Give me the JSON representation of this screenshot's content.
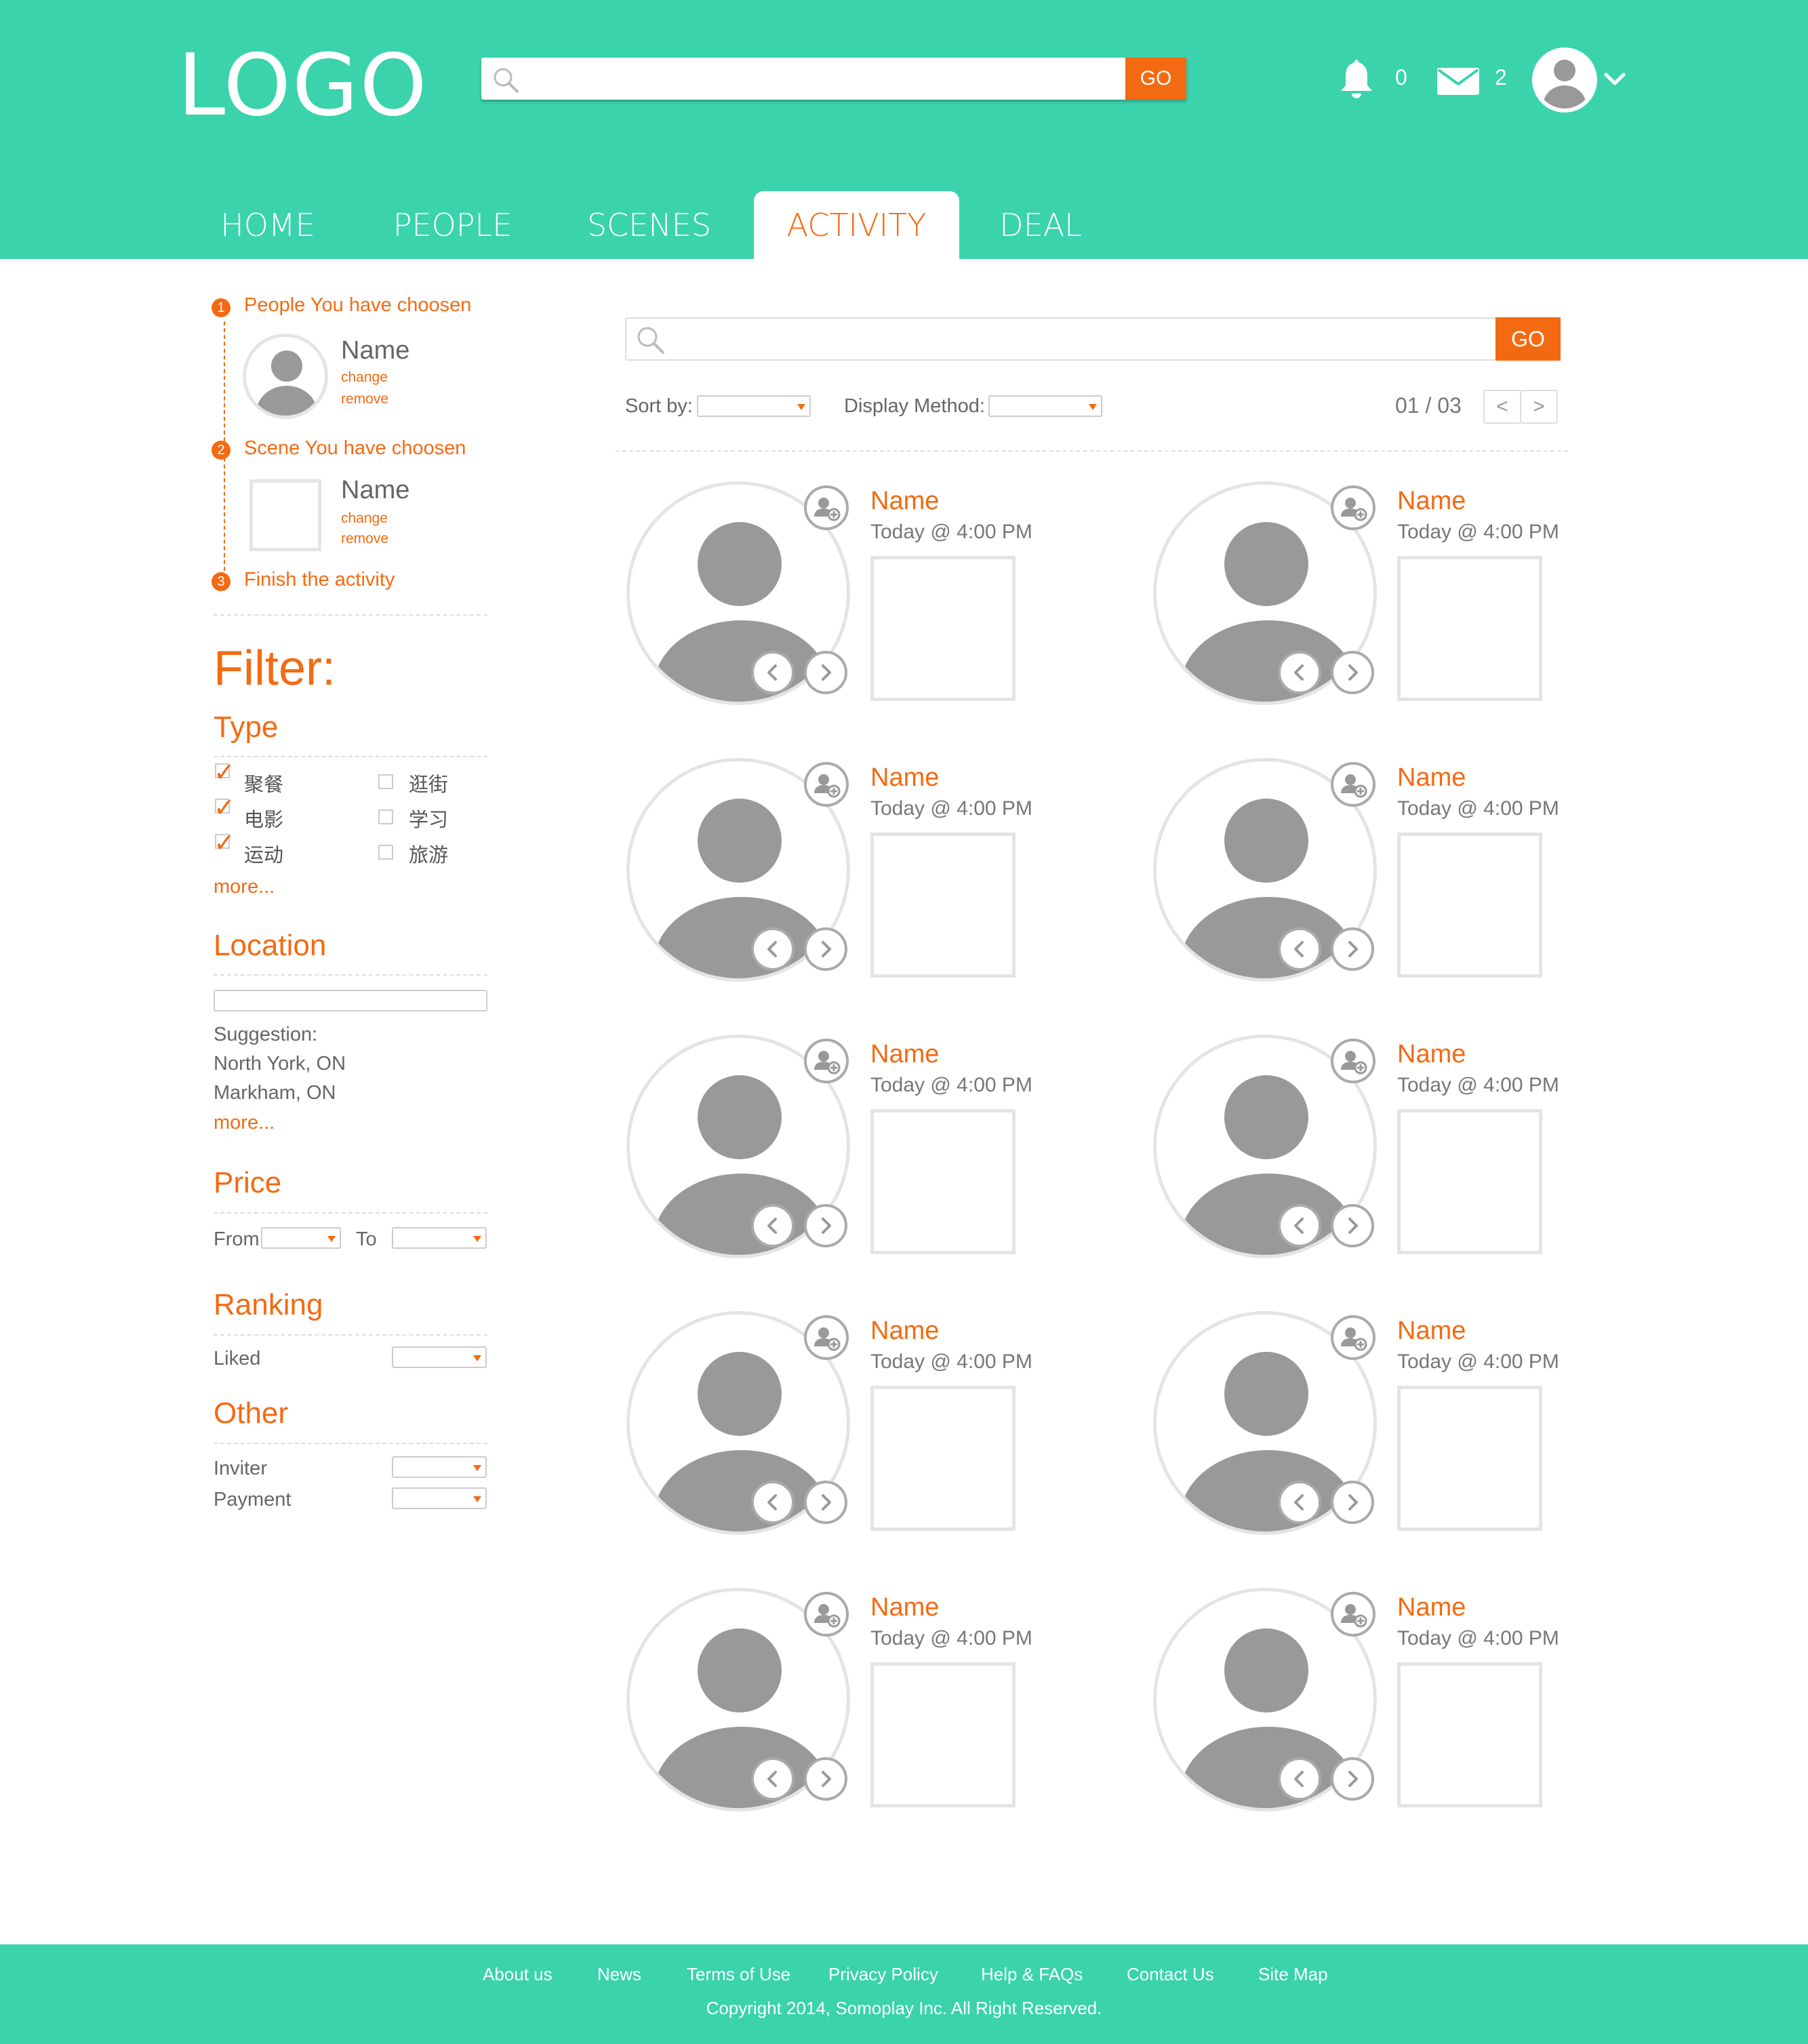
{
  "header": {
    "logo": "LOGO",
    "search_placeholder": "",
    "search_button": "GO",
    "notifications_count": "0",
    "messages_count": "2"
  },
  "nav": {
    "tabs": [
      {
        "label": "HOME"
      },
      {
        "label": "PEOPLE"
      },
      {
        "label": "SCENES"
      },
      {
        "label": "ACTIVITY",
        "active": true
      },
      {
        "label": "DEAL"
      }
    ]
  },
  "steps": [
    {
      "number": "1",
      "title": "People You have choosen",
      "name": "Name",
      "change": "change",
      "remove": "remove"
    },
    {
      "number": "2",
      "title": "Scene You have choosen",
      "name": "Name",
      "change": "change",
      "remove": "remove"
    },
    {
      "number": "3",
      "title": "Finish the activity"
    }
  ],
  "filter": {
    "title": "Filter:",
    "type": {
      "title": "Type",
      "options": [
        {
          "label": "聚餐",
          "checked": true
        },
        {
          "label": "逛街",
          "checked": false
        },
        {
          "label": "电影",
          "checked": true
        },
        {
          "label": "学习",
          "checked": false
        },
        {
          "label": "运动",
          "checked": true
        },
        {
          "label": "旅游",
          "checked": false
        }
      ],
      "more": "more..."
    },
    "location": {
      "title": "Location",
      "input_value": "",
      "suggestion_label": "Suggestion:",
      "suggestions": [
        "North York, ON",
        "Markham, ON"
      ],
      "more": "more..."
    },
    "price": {
      "title": "Price",
      "from_label": "From",
      "to_label": "To"
    },
    "ranking": {
      "title": "Ranking",
      "liked_label": "Liked"
    },
    "other": {
      "title": "Other",
      "inviter_label": "Inviter",
      "payment_label": "Payment"
    }
  },
  "main": {
    "search_button": "GO",
    "sort_label": "Sort by:",
    "display_label": "Display Method:",
    "page_current": "01",
    "page_sep": "/",
    "page_total": "03",
    "prev": "<",
    "next": ">",
    "cards": [
      {
        "name": "Name",
        "time": "Today @ 4:00 PM"
      },
      {
        "name": "Name",
        "time": "Today @ 4:00 PM"
      },
      {
        "name": "Name",
        "time": "Today @ 4:00 PM"
      },
      {
        "name": "Name",
        "time": "Today @ 4:00 PM"
      },
      {
        "name": "Name",
        "time": "Today @ 4:00 PM"
      },
      {
        "name": "Name",
        "time": "Today @ 4:00 PM"
      },
      {
        "name": "Name",
        "time": "Today @ 4:00 PM"
      },
      {
        "name": "Name",
        "time": "Today @ 4:00 PM"
      },
      {
        "name": "Name",
        "time": "Today @ 4:00 PM"
      },
      {
        "name": "Name",
        "time": "Today @ 4:00 PM"
      }
    ]
  },
  "footer": {
    "links": [
      "About us",
      "News",
      "Terms of Use",
      "Privacy Policy",
      "Help & FAQs",
      "Contact Us",
      "Site Map"
    ],
    "copyright": "Copyright 2014, Somoplay Inc. All Right Reserved."
  },
  "colors": {
    "brand": "#3ad3ab",
    "accent": "#f46a12",
    "placeholder": "#999999"
  },
  "icons": [
    "search-icon",
    "bell-icon",
    "mail-icon",
    "avatar-icon",
    "chevron-down-icon",
    "add-person-icon",
    "chevron-left-icon",
    "chevron-right-icon"
  ]
}
